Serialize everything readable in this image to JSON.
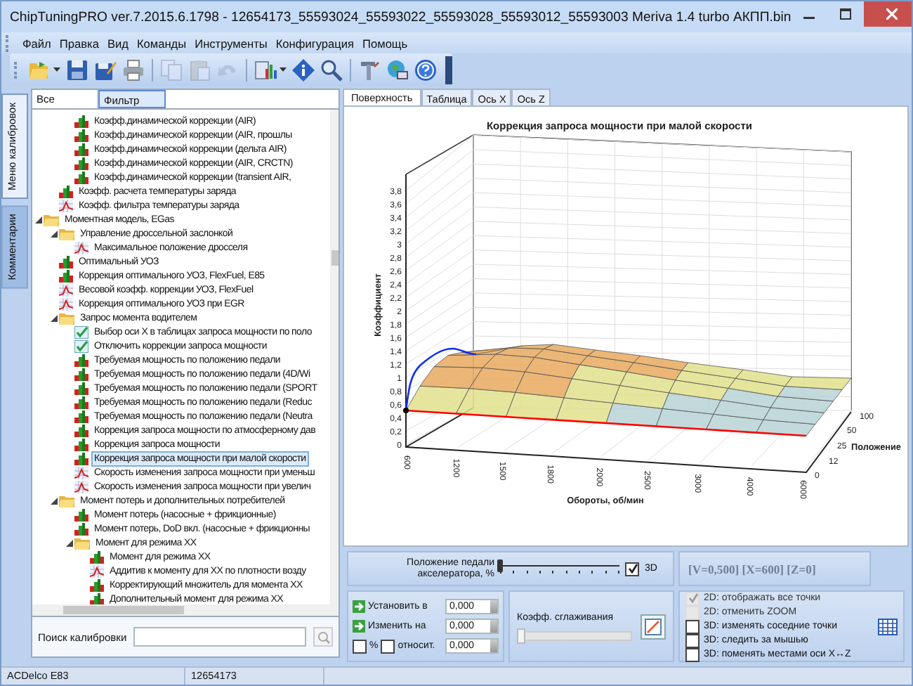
{
  "window": {
    "title": "ChipTuningPRO ver.7.2015.6.1798 - 12654173_55593024_55593022_55593028_55593012_55593003 Meriva 1.4 turbo АКПП.bin"
  },
  "menu": [
    "Файл",
    "Правка",
    "Вид",
    "Команды",
    "Инструменты",
    "Конфигурация",
    "Помощь"
  ],
  "toolbar": [
    {
      "kind": "open",
      "disabled": false,
      "dropdown": true
    },
    {
      "kind": "save",
      "disabled": false,
      "dropdown": false
    },
    {
      "kind": "save-as",
      "disabled": false,
      "dropdown": false
    },
    {
      "kind": "print",
      "disabled": false,
      "dropdown": false
    },
    {
      "kind": "separator"
    },
    {
      "kind": "copy",
      "disabled": true,
      "dropdown": false
    },
    {
      "kind": "paste",
      "disabled": true,
      "dropdown": false
    },
    {
      "kind": "undo",
      "disabled": true,
      "dropdown": false
    },
    {
      "kind": "separator"
    },
    {
      "kind": "chart",
      "disabled": false,
      "dropdown": true
    },
    {
      "kind": "info",
      "disabled": false,
      "dropdown": false
    },
    {
      "kind": "zoom",
      "disabled": false,
      "dropdown": false
    },
    {
      "kind": "separator"
    },
    {
      "kind": "tools",
      "disabled": false,
      "dropdown": false
    },
    {
      "kind": "network",
      "disabled": false,
      "dropdown": false
    },
    {
      "kind": "help",
      "disabled": false,
      "dropdown": false
    }
  ],
  "side_tabs": [
    {
      "label": "Меню калибровок",
      "selected": true
    },
    {
      "label": "Комментарии",
      "selected": false
    }
  ],
  "tree_tabs": [
    {
      "label": "Все",
      "selected": false
    },
    {
      "label": "Фильтр",
      "selected": true
    }
  ],
  "tree": [
    {
      "children": [
        {
          "children": [
            {
              "label": "Коэфф.динамической коррекции (AIR)",
              "kind": "table",
              "selected": false
            },
            {
              "label": "Коэфф.динамической коррекции (AIR, прошлы",
              "kind": "table",
              "selected": false
            },
            {
              "label": "Коэфф.динамической коррекции (дельта AIR)",
              "kind": "table",
              "selected": false
            },
            {
              "label": "Коэфф.динамической коррекции (AIR, CRCTN)",
              "kind": "table",
              "selected": false
            },
            {
              "label": "Коэфф.динамической коррекции (transient AIR,",
              "kind": "table",
              "selected": false
            }
          ]
        },
        {
          "label": "Коэфф. расчета температуры заряда",
          "kind": "table",
          "selected": false
        },
        {
          "label": "Коэфф. фильтра температуры заряда",
          "kind": "curve",
          "selected": false
        }
      ]
    },
    {
      "label": "Моментная модель, EGas",
      "kind": "folder",
      "selected": false,
      "expanded": true,
      "children": [
        {
          "label": "Управление дроссельной заслонкой",
          "kind": "folder",
          "selected": false,
          "expanded": true,
          "children": [
            {
              "label": "Максимальное положение дросселя",
              "kind": "curve",
              "selected": false
            }
          ]
        },
        {
          "label": "Оптимальный УОЗ",
          "kind": "table",
          "selected": false
        },
        {
          "label": "Коррекция оптимального УОЗ, FlexFuel, E85",
          "kind": "table",
          "selected": false
        },
        {
          "label": "Весовой коэфф. коррекции УОЗ, FlexFuel",
          "kind": "curve",
          "selected": false
        },
        {
          "label": "Коррекция оптимального УОЗ при EGR",
          "kind": "curve",
          "selected": false
        },
        {
          "label": "Запрос момента водителем",
          "kind": "folder",
          "selected": false,
          "expanded": true,
          "children": [
            {
              "label": "Выбор оси X в таблицах запроса мощности по поло",
              "kind": "flag",
              "selected": false
            },
            {
              "label": "Отключить коррекции запроса мощности",
              "kind": "flag",
              "selected": false
            },
            {
              "label": "Требуемая мощность по положению педали",
              "kind": "table",
              "selected": false
            },
            {
              "label": "Требуемая мощность по положению педали (4D/Wi",
              "kind": "table",
              "selected": false
            },
            {
              "label": "Требуемая мощность по положению педали (SPORT",
              "kind": "table",
              "selected": false
            },
            {
              "label": "Требуемая мощность по положению педали (Reduc",
              "kind": "table",
              "selected": false
            },
            {
              "label": "Требуемая мощность по положению педали (Neutra",
              "kind": "table",
              "selected": false
            },
            {
              "label": "Коррекция запроса мощности по атмосферному дав",
              "kind": "table",
              "selected": false
            },
            {
              "label": "Коррекция запроса мощности",
              "kind": "table",
              "selected": false
            },
            {
              "label": "Коррекция запроса мощности при малой скорости",
              "kind": "table",
              "selected": true
            },
            {
              "label": "Скорость изменения запроса мощности при уменьш",
              "kind": "curve",
              "selected": false
            },
            {
              "label": "Скорость изменения запроса мощности при увелич",
              "kind": "curve",
              "selected": false
            }
          ]
        },
        {
          "label": "Момент потерь и дополнительных потребителей",
          "kind": "folder",
          "selected": false,
          "expanded": true,
          "children": [
            {
              "label": "Момент потерь (насосные + фрикционные)",
              "kind": "table",
              "selected": false
            },
            {
              "label": "Момент потерь, DoD вкл. (насосные + фрикционны",
              "kind": "table",
              "selected": false
            },
            {
              "label": "Момент для режима XX",
              "kind": "folder",
              "selected": false,
              "expanded": true,
              "children": [
                {
                  "label": "Момент для режима XX",
                  "kind": "table",
                  "selected": false
                },
                {
                  "label": "Аддитив к моменту для XX по плотности возду",
                  "kind": "curve",
                  "selected": false
                },
                {
                  "label": "Корректирующий множитель для момента XX",
                  "kind": "table",
                  "selected": false
                },
                {
                  "label": "Дополнительный момент для режима XX",
                  "kind": "table",
                  "selected": false
                }
              ]
            }
          ]
        }
      ]
    }
  ],
  "search": {
    "label": "Поиск калибровки"
  },
  "view_tabs": [
    {
      "label": "Поверхность",
      "selected": true
    },
    {
      "label": "Таблица",
      "selected": false
    },
    {
      "label": "Ось X",
      "selected": false
    },
    {
      "label": "Ось Z",
      "selected": false
    }
  ],
  "chart": {
    "title": "Коррекция запроса мощности при малой скорости",
    "ylabel": "Коэффициент",
    "xlabel": "Обороты, об/мин",
    "zlabel": "Положение",
    "yticks": [
      "3,8",
      "3,6",
      "3,4",
      "3,2",
      "3",
      "2,8",
      "2,6",
      "2,4",
      "2,2",
      "2",
      "1,8",
      "1,6",
      "1,4",
      "1,2",
      "1",
      "0,8",
      "0,6",
      "0,4",
      "0,2",
      "0"
    ],
    "xticks": [
      "600",
      "1200",
      "1500",
      "1800",
      "2000",
      "2500",
      "3000",
      "4000",
      "6000"
    ],
    "zticks": [
      "0",
      "12",
      "25",
      "50",
      "100"
    ]
  },
  "pedal": {
    "label": "Положение педали акселератора, %",
    "level": 0,
    "mode_3d": {
      "label": "3D",
      "checked": true
    }
  },
  "readout": "[V=0,500] [X=600] [Z=0]",
  "edit": {
    "set": {
      "label": "Установить в",
      "value": "0,000"
    },
    "change": {
      "label": "Изменить на",
      "value": "0,000"
    },
    "percent": {
      "label": "%",
      "checked": false
    },
    "relative": {
      "label": "относит.",
      "checked": false
    },
    "relative_value": "0,000"
  },
  "smoothing": {
    "label": "Коэфф. сглаживания",
    "level": 0
  },
  "options": [
    {
      "label": "2D: отображать все точки",
      "checked": true,
      "disabled": true
    },
    {
      "label": "2D: отменить ZOOM",
      "checked": false,
      "disabled": true
    },
    {
      "label": "3D: изменять соседние точки",
      "checked": false,
      "disabled": false
    },
    {
      "label": "3D: следить за мышью",
      "checked": false,
      "disabled": false
    },
    {
      "label": "3D: поменять местами оси X↔Z",
      "checked": false,
      "disabled": false
    }
  ],
  "status_bar": [
    "ACDelco E83",
    "12654173"
  ]
}
